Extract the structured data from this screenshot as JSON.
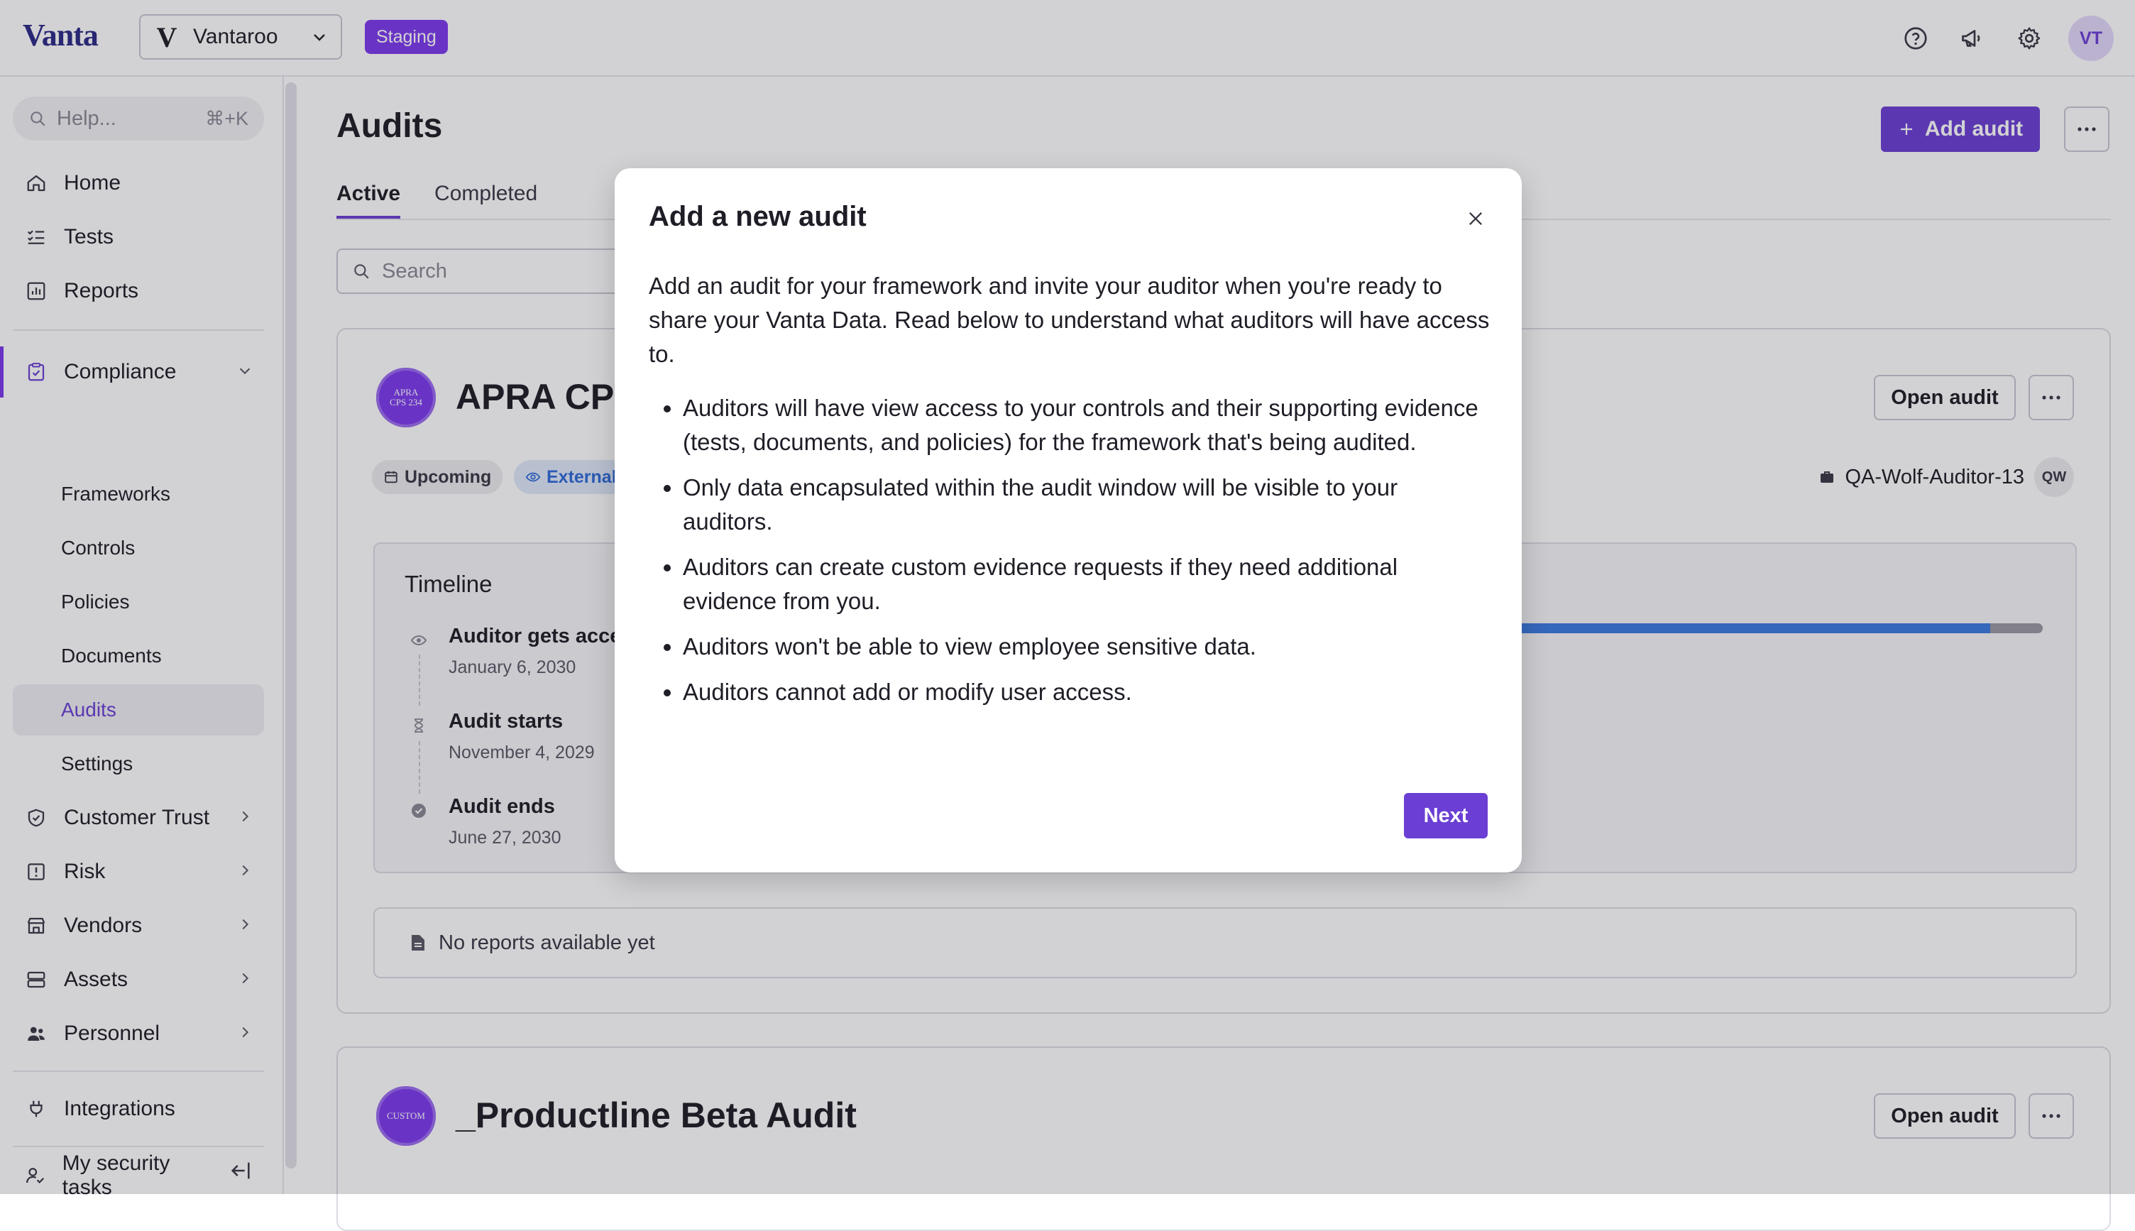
{
  "app": {
    "logo": "Vanta",
    "org_logo": "V",
    "org_name": "Vantaroo",
    "env_badge": "Staging",
    "user_initials": "VT",
    "colors": {
      "accent": "#6b3fd4",
      "badge": "#7c3aed",
      "external": "#2f6ad9"
    },
    "icons": [
      "help-circle-icon",
      "megaphone-icon",
      "gear-icon"
    ]
  },
  "sidebar": {
    "help_placeholder": "Help...",
    "help_shortcut": "⌘+K",
    "items": {
      "home": "Home",
      "tests": "Tests",
      "reports": "Reports",
      "compliance": "Compliance",
      "frameworks": "Frameworks",
      "controls": "Controls",
      "policies": "Policies",
      "documents": "Documents",
      "audits": "Audits",
      "settings": "Settings",
      "customer_trust": "Customer Trust",
      "risk": "Risk",
      "vendors": "Vendors",
      "assets": "Assets",
      "personnel": "Personnel",
      "integrations": "Integrations",
      "my_security_tasks": "My security tasks"
    },
    "active": "Audits"
  },
  "main": {
    "title": "Audits",
    "add_audit_label": "Add audit",
    "tabs": [
      "Active",
      "Completed"
    ],
    "active_tab": "Active",
    "search_placeholder": "Search",
    "audits": [
      {
        "badge_line1": "APRA",
        "badge_line2": "CPS 234",
        "title": "APRA CPS",
        "open_label": "Open audit",
        "status": "Upcoming",
        "visibility": "External",
        "auditor": "QA-Wolf-Auditor-13",
        "auditor_initials": "QW",
        "timeline_title": "Timeline",
        "timeline": [
          {
            "label": "Auditor gets acce",
            "date": "January 6, 2030"
          },
          {
            "label": "Audit starts",
            "date": "November 4, 2029"
          },
          {
            "label": "Audit ends",
            "date": "June 27, 2030"
          }
        ],
        "progress": 0.9,
        "reports_text": "No reports available yet"
      },
      {
        "badge_line1": "CUSTOM",
        "title": "_Productline Beta Audit",
        "open_label": "Open audit"
      }
    ]
  },
  "modal": {
    "title": "Add a new audit",
    "intro": "Add an audit for your framework and invite your auditor when you're ready to share your Vanta Data. Read below to understand what auditors will have access to.",
    "bullets": [
      "Auditors will have view access to your controls and their supporting evidence (tests, documents, and policies) for the framework that's being audited.",
      "Only data encapsulated within the audit window will be visible to your auditors.",
      "Auditors can create custom evidence requests if they need additional evidence from you.",
      "Auditors won't be able to view employee sensitive data.",
      "Auditors cannot add or modify user access."
    ],
    "next_label": "Next"
  }
}
